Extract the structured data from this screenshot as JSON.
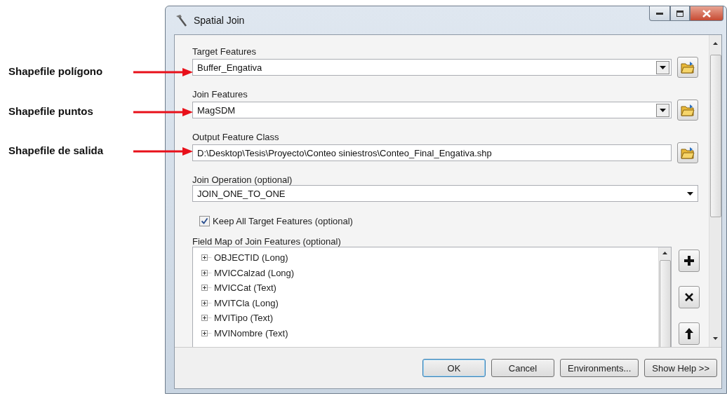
{
  "window": {
    "title": "Spatial Join"
  },
  "annotations": [
    {
      "label": "Shapefile polígono"
    },
    {
      "label": "Shapefile puntos"
    },
    {
      "label": "Shapefile de salida"
    }
  ],
  "fields": [
    {
      "kind": "combo",
      "label": "Target Features",
      "value": "Buffer_Engativa"
    },
    {
      "kind": "combo",
      "label": "Join Features",
      "value": "MagSDM"
    },
    {
      "kind": "path",
      "label": "Output Feature Class",
      "value": "D:\\Desktop\\Tesis\\Proyecto\\Conteo siniestros\\Conteo_Final_Engativa.shp"
    },
    {
      "kind": "select",
      "label": "Join Operation (optional)",
      "value": "JOIN_ONE_TO_ONE"
    },
    {
      "kind": "checkbox",
      "label": "Keep All Target Features (optional)",
      "checked": true
    }
  ],
  "field_map": {
    "label": "Field Map of Join Features (optional)",
    "items": [
      "OBJECTID (Long)",
      "MVICCalzad (Long)",
      "MVICCat (Text)",
      "MVITCla (Long)",
      "MVITipo (Text)",
      "MVINombre (Text)"
    ]
  },
  "buttons": [
    {
      "label": "OK",
      "default": true
    },
    {
      "label": "Cancel",
      "default": false
    },
    {
      "label": "Environments...",
      "default": false
    },
    {
      "label": "Show Help >>",
      "default": false
    }
  ]
}
